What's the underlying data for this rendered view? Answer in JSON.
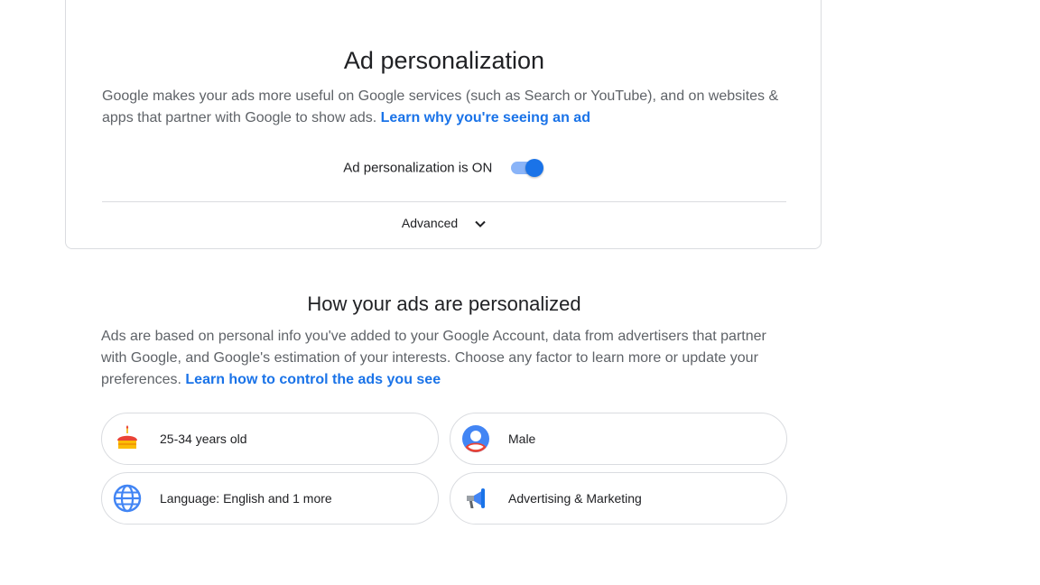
{
  "card": {
    "title": "Ad personalization",
    "description": "Google makes your ads more useful on Google services (such as Search or YouTube), and on websites & apps that partner with Google to show ads.",
    "learn_link": "Learn why you're seeing an ad",
    "toggle_label": "Ad personalization is ON",
    "toggle_on": true,
    "advanced_label": "Advanced"
  },
  "personalized": {
    "title": "How your ads are personalized",
    "description": "Ads are based on personal info you've added to your Google Account, data from advertisers that partner with Google, and Google's estimation of your interests. Choose any factor to learn more or update your preferences.",
    "learn_link": "Learn how to control the ads you see",
    "factors": [
      {
        "label": "25-34 years old",
        "icon": "birthday-cake-icon"
      },
      {
        "label": "Male",
        "icon": "person-icon"
      },
      {
        "label": "Language: English and 1 more",
        "icon": "globe-icon"
      },
      {
        "label": "Advertising & Marketing",
        "icon": "megaphone-icon"
      }
    ]
  },
  "colors": {
    "accent": "#1a73e8",
    "toggle_track": "#8ab4f8",
    "text_primary": "#202124",
    "text_secondary": "#5f6368",
    "border": "#dadce0"
  }
}
